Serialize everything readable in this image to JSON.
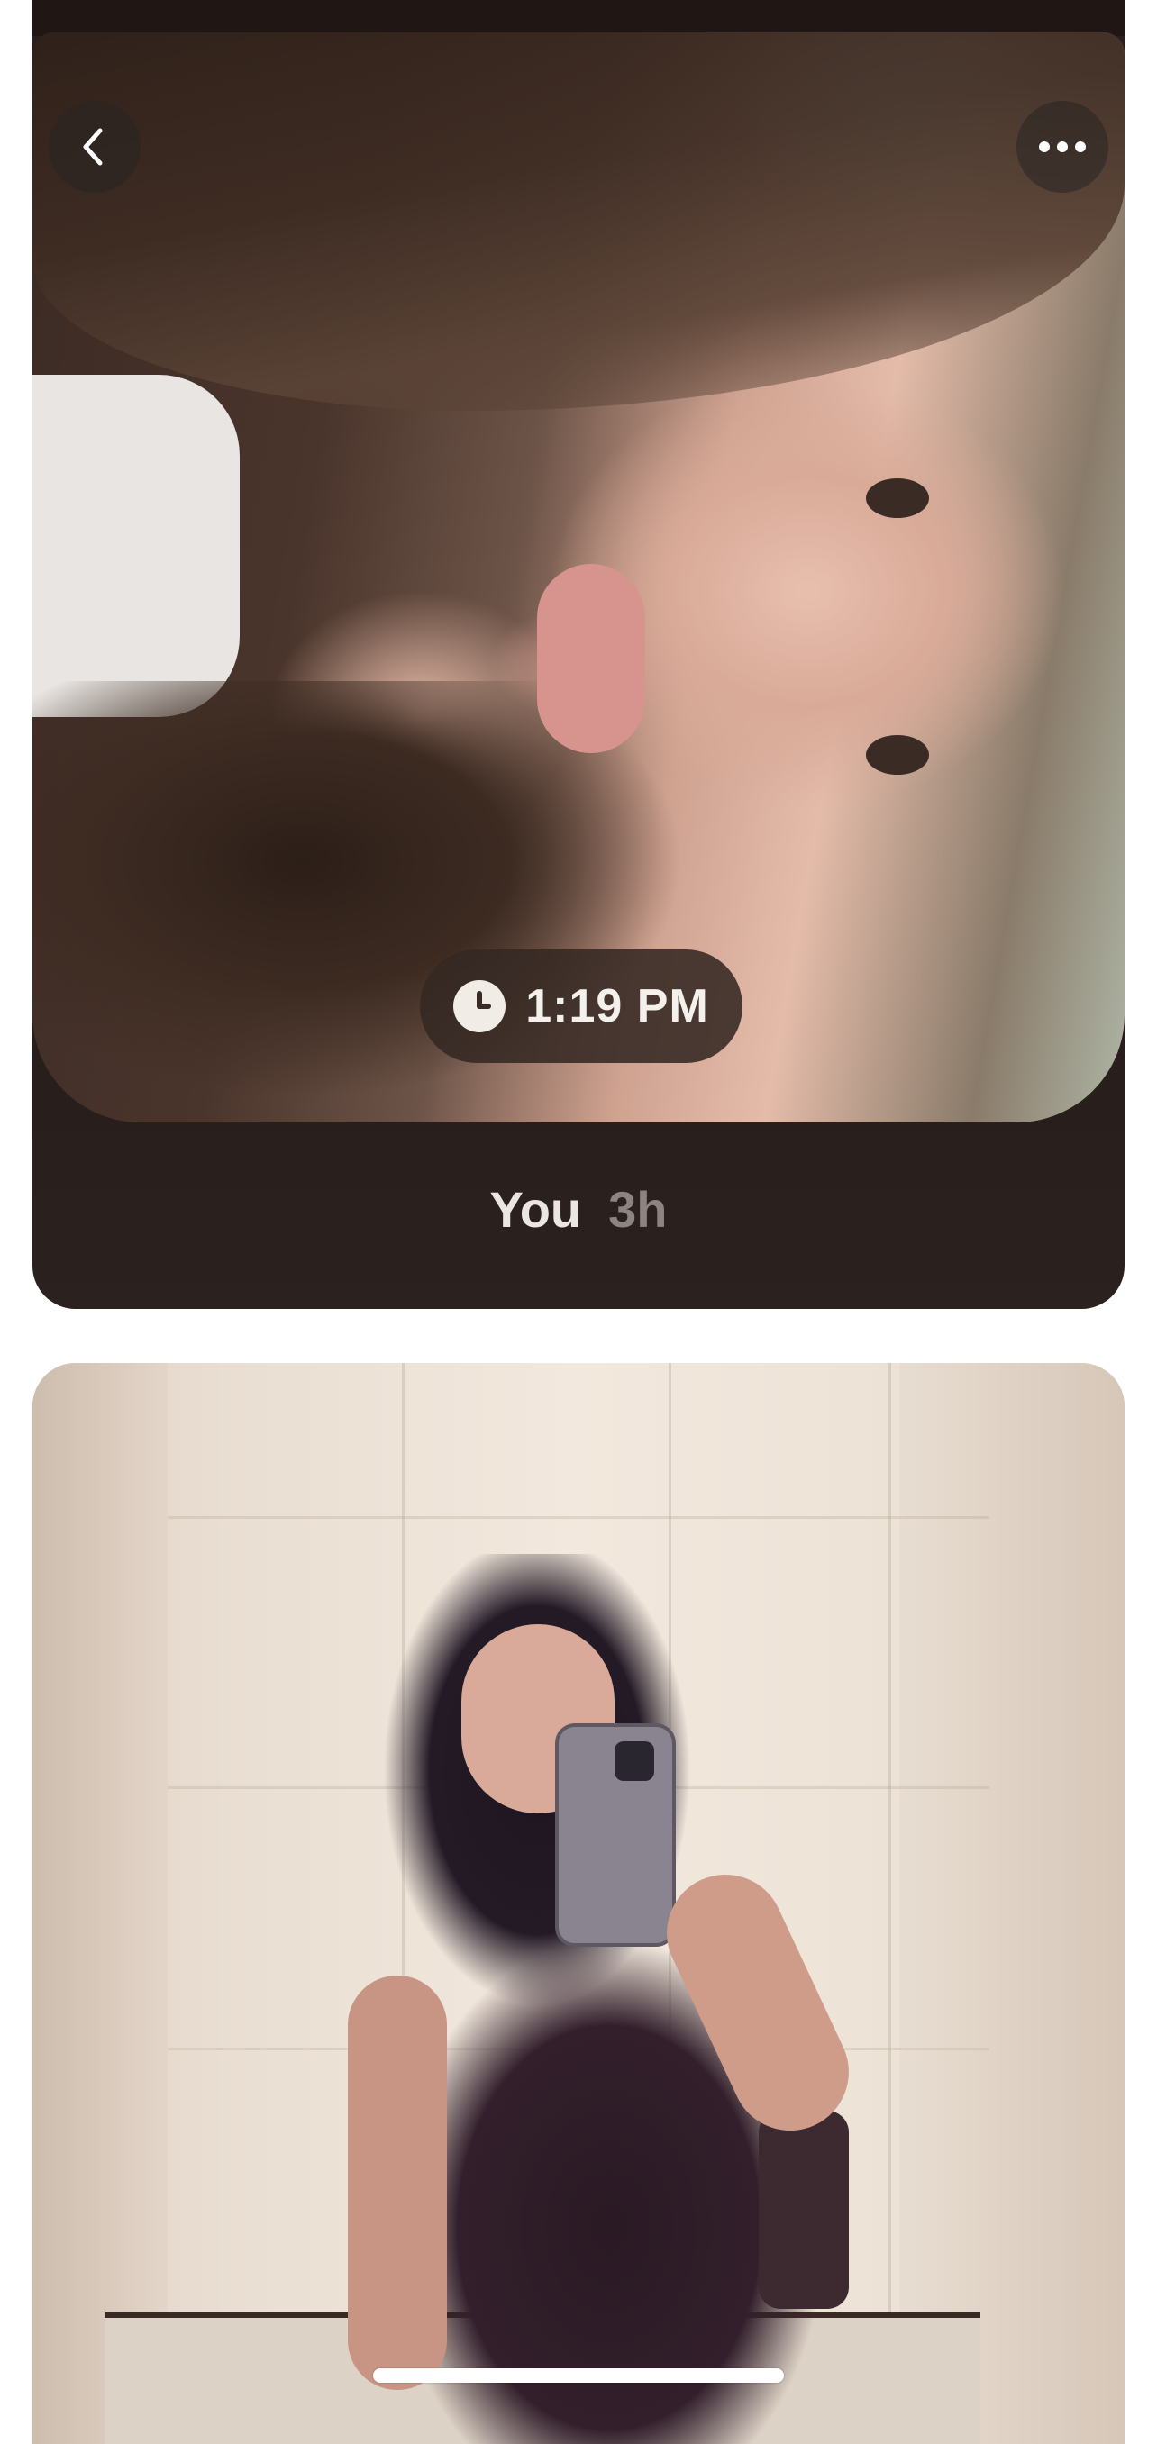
{
  "post": {
    "time": "1:19 PM",
    "author": "You",
    "ago": "3h"
  },
  "icons": {
    "back": "chevron-left-icon",
    "more": "ellipsis-icon",
    "clock": "clock-icon"
  },
  "colors": {
    "card_background": "#241a18",
    "pill_background": "#342822",
    "caption_author": "#ece6e2",
    "caption_time": "#8c8480"
  }
}
